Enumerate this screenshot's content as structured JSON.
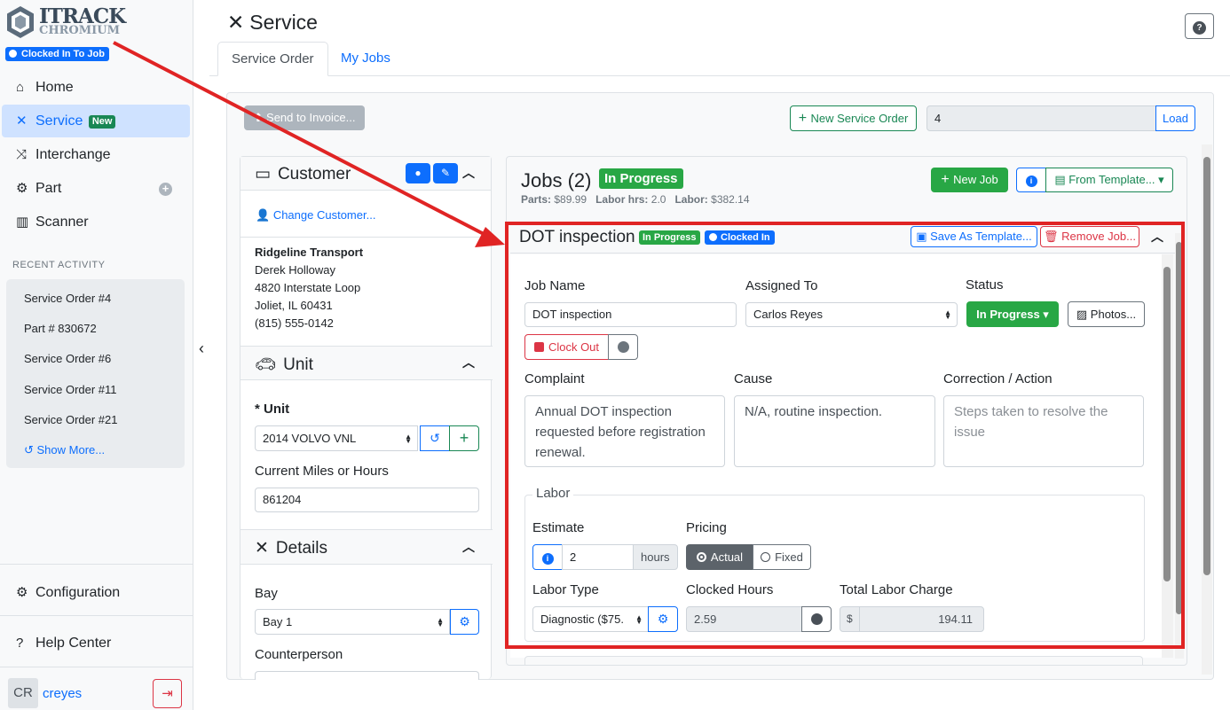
{
  "brand": {
    "line1": "ITRACK",
    "line2": "CHROMIUM",
    "clocked_badge": "Clocked In To Job"
  },
  "nav": {
    "home": "Home",
    "service": "Service",
    "service_badge": "New",
    "interchange": "Interchange",
    "part": "Part",
    "scanner": "Scanner",
    "configuration": "Configuration",
    "help_center": "Help Center"
  },
  "recent": {
    "heading": "RECENT ACTIVITY",
    "items": [
      "Service Order #4",
      "Part # 830672",
      "Service Order #6",
      "Service Order #11",
      "Service Order #21"
    ],
    "show_more": "Show More..."
  },
  "user": {
    "initials": "CR",
    "username": "creyes"
  },
  "header": {
    "title": "Service"
  },
  "tabs": {
    "service_order": "Service Order",
    "my_jobs": "My Jobs"
  },
  "toolbar": {
    "send_to_invoice": "Send to Invoice...",
    "new_service_order": "New Service Order",
    "load_value": "4",
    "load": "Load"
  },
  "customer": {
    "title": "Customer",
    "change": "Change Customer...",
    "company": "Ridgeline Transport",
    "contact": "Derek Holloway",
    "address1": "4820 Interstate Loop",
    "address2": "Joliet, IL 60431",
    "phone": "(815) 555-0142"
  },
  "unit": {
    "title": "Unit",
    "unit_label": "* Unit",
    "unit_value": "2014 VOLVO VNL",
    "miles_label": "Current Miles or Hours",
    "miles_value": "861204"
  },
  "details": {
    "title": "Details",
    "bay_label": "Bay",
    "bay_value": "Bay 1",
    "counterperson_label": "Counterperson"
  },
  "jobs": {
    "title": "Jobs (2)",
    "status": "In Progress",
    "parts_label": "Parts:",
    "parts_value": "$89.99",
    "labor_hrs_label": "Labor hrs:",
    "labor_hrs_value": "2.0",
    "labor_label": "Labor:",
    "labor_value": "$382.14",
    "new_job": "New Job",
    "from_template": "From Template..."
  },
  "job": {
    "name": "DOT inspection",
    "status_badge": "In Progress",
    "clocked_badge": "Clocked In",
    "save_template": "Save As Template...",
    "remove_job": "Remove Job...",
    "job_name_label": "Job Name",
    "job_name_value": "DOT inspection",
    "assigned_label": "Assigned To",
    "assigned_value": "Carlos Reyes",
    "status_label": "Status",
    "status_value": "In Progress",
    "photos": "Photos...",
    "clock_out": "Clock Out",
    "complaint_label": "Complaint",
    "complaint_value": "Annual DOT inspection requested before registration renewal.",
    "cause_label": "Cause",
    "cause_value": "N/A, routine inspection.",
    "correction_label": "Correction / Action",
    "correction_placeholder": "Steps taken to resolve the issue",
    "labor": {
      "legend": "Labor",
      "estimate_label": "Estimate",
      "estimate_value": "2",
      "estimate_unit": "hours",
      "pricing_label": "Pricing",
      "pricing_actual": "Actual",
      "pricing_fixed": "Fixed",
      "labor_type_label": "Labor Type",
      "labor_type_value": "Diagnostic ($75.",
      "clocked_label": "Clocked Hours",
      "clocked_value": "2.59",
      "total_label": "Total Labor Charge",
      "currency": "$",
      "total_value": "194.11"
    }
  },
  "colors": {
    "primary": "#0d6efd",
    "success": "#28a745",
    "danger": "#dc3545",
    "annotation": "#e02424"
  }
}
